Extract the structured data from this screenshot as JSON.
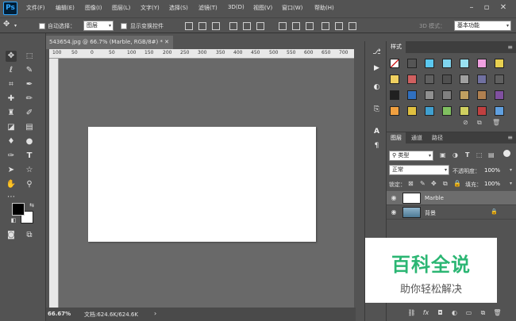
{
  "menubar": {
    "logo": "Ps",
    "items": [
      "文件(F)",
      "编辑(E)",
      "图像(I)",
      "图层(L)",
      "文字(Y)",
      "选择(S)",
      "滤镜(T)",
      "3D(D)",
      "视图(V)",
      "窗口(W)",
      "帮助(H)"
    ],
    "window_controls": [
      "minimize-icon",
      "restore-icon",
      "close-icon"
    ]
  },
  "options_bar": {
    "auto_select_label": "自动选择：",
    "auto_select_value": "图层",
    "show_transform_label": "显示变换控件",
    "mode_3d_label": "3D 模式：",
    "workspace_value": "基本功能"
  },
  "document": {
    "tab_title": "543654.jpg @ 66.7% (Marble, RGB/8#) *",
    "ruler_numbers": [
      "100",
      "50",
      "0",
      "50",
      "100",
      "150",
      "200",
      "250",
      "300",
      "350",
      "400",
      "450",
      "500",
      "550",
      "600",
      "650",
      "700"
    ],
    "zoom": "66.67%",
    "doc_info": "文档:624.6K/624.6K"
  },
  "styles_panel": {
    "tab": "样式",
    "swatch_colors": [
      "#ffffff",
      "#555555",
      "#5bc8f0",
      "#7fd4ee",
      "#99e2f2",
      "#f0a0e0",
      "#e8d050",
      "#f0d060",
      "#d06060",
      "#606060",
      "#505050",
      "#a0a0a0",
      "#7070a0",
      "#606060",
      "#202020",
      "#3070c0",
      "#909090",
      "#808080",
      "#c0a060",
      "#b08050",
      "#8050a0",
      "#f0a040",
      "#e0c040",
      "#40a0d0",
      "#80c060",
      "#d0d060",
      "#c04040",
      "#60a0e0"
    ]
  },
  "layers_panel": {
    "tabs": [
      "图层",
      "通道",
      "路径"
    ],
    "filter_kind": "类型",
    "blend_mode": "正常",
    "opacity_label": "不透明度：",
    "opacity_value": "100%",
    "lock_label": "锁定：",
    "fill_label": "填充：",
    "fill_value": "100%",
    "layers": [
      {
        "name": "Marble",
        "selected": true,
        "thumb_color": "#ffffff"
      },
      {
        "name": "背景",
        "selected": false,
        "thumb_color": "#5a8aa8"
      }
    ]
  },
  "watermark": {
    "title": "百科全说",
    "subtitle": "助你轻松解决"
  }
}
